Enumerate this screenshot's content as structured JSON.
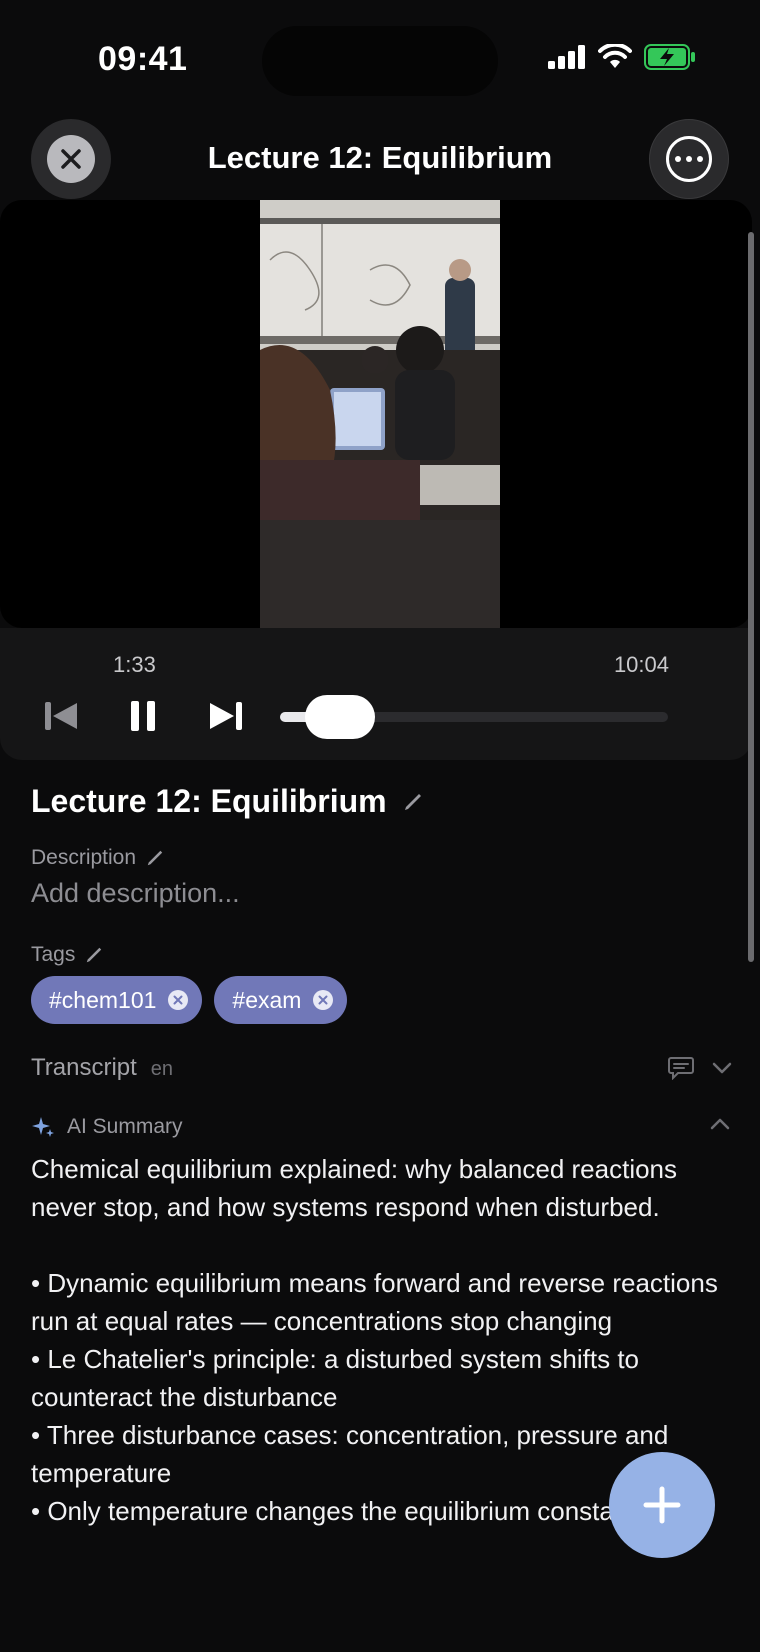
{
  "status_bar": {
    "time": "09:41"
  },
  "header": {
    "title": "Lecture 12: Equilibrium"
  },
  "player": {
    "current_time": "1:33",
    "total_time": "10:04",
    "progress": 0.155
  },
  "recording": {
    "title": "Lecture 12: Equilibrium",
    "description_label": "Description",
    "description_placeholder": "Add description...",
    "tags_label": "Tags",
    "tags": [
      "#chem101",
      "#exam"
    ]
  },
  "transcript": {
    "label": "Transcript",
    "language": "en"
  },
  "ai_summary": {
    "label": "AI Summary",
    "intro": "Chemical equilibrium explained: why balanced reactions never stop, and how systems respond when disturbed.",
    "bullets": [
      "• Dynamic equilibrium means forward and reverse reactions run at equal rates — concentrations stop changing",
      "• Le Chatelier's principle: a disturbed system shifts to counteract the disturbance",
      "• Three disturbance cases: concentration, pressure and temperature",
      "• Only temperature changes the equilibrium constant itself"
    ]
  },
  "colors": {
    "tag": "#7178b8",
    "fab": "#96b2e6",
    "battery": "#34c759"
  }
}
